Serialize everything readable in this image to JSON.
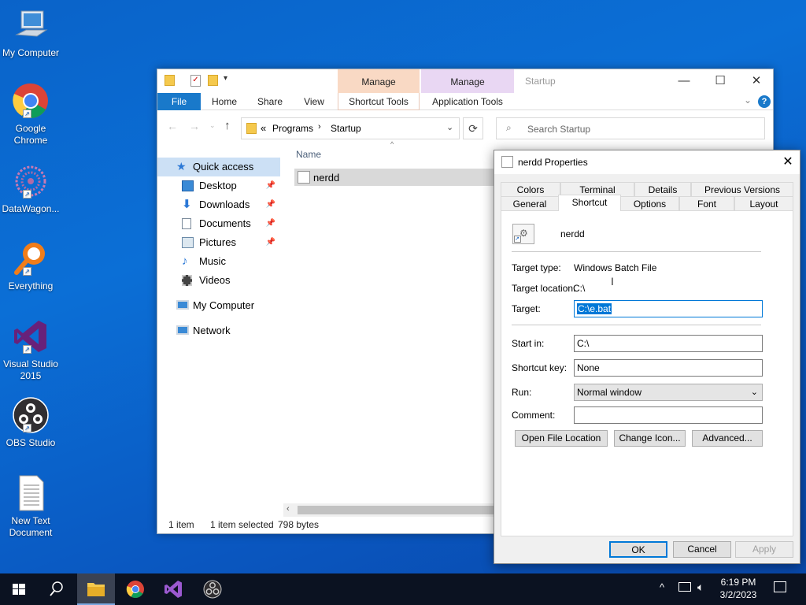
{
  "desktop": {
    "icons": [
      {
        "label": "My Computer"
      },
      {
        "label": "Google Chrome"
      },
      {
        "label": "DataWagon..."
      },
      {
        "label": "Everything"
      },
      {
        "label": "Visual Studio 2015"
      },
      {
        "label": "OBS Studio"
      },
      {
        "label": "New Text Document"
      }
    ]
  },
  "explorer": {
    "title": "Startup",
    "context_tabs": [
      {
        "group": "Manage",
        "tab": "Shortcut Tools",
        "color": "#f9d9c4"
      },
      {
        "group": "Manage",
        "tab": "Application Tools",
        "color": "#e9d7f3"
      }
    ],
    "ribbon_tabs": [
      "File",
      "Home",
      "Share",
      "View"
    ],
    "address": {
      "prefix": "«",
      "parts": [
        "Programs",
        "Startup"
      ]
    },
    "search_placeholder": "Search Startup",
    "column_header": "Name",
    "file": {
      "name": "nerdd"
    },
    "nav": {
      "quick_access": "Quick access",
      "items": [
        "Desktop",
        "Downloads",
        "Documents",
        "Pictures",
        "Music",
        "Videos"
      ],
      "my_computer": "My Computer",
      "network": "Network"
    },
    "status": {
      "count": "1 item",
      "selected": "1 item selected",
      "size": "798 bytes"
    }
  },
  "properties": {
    "title": "nerdd Properties",
    "tabs_row1": [
      "Colors",
      "Terminal",
      "Details",
      "Previous Versions"
    ],
    "tabs_row2": [
      "General",
      "Shortcut",
      "Options",
      "Font",
      "Layout"
    ],
    "active_tab": "Shortcut",
    "name": "nerdd",
    "target_type_label": "Target type:",
    "target_type": "Windows Batch File",
    "target_location_label": "Target location:",
    "target_location": "C:\\",
    "target_label": "Target:",
    "target": "C:\\e.bat",
    "start_in_label": "Start in:",
    "start_in": "C:\\",
    "shortcut_key_label": "Shortcut key:",
    "shortcut_key": "None",
    "run_label": "Run:",
    "run": "Normal window",
    "comment_label": "Comment:",
    "comment": "",
    "buttons": {
      "open_location": "Open File Location",
      "change_icon": "Change Icon...",
      "advanced": "Advanced..."
    },
    "footer": {
      "ok": "OK",
      "cancel": "Cancel",
      "apply": "Apply"
    }
  },
  "taskbar": {
    "time": "6:19 PM",
    "date": "3/2/2023",
    "accent": "#7aa7e0"
  }
}
